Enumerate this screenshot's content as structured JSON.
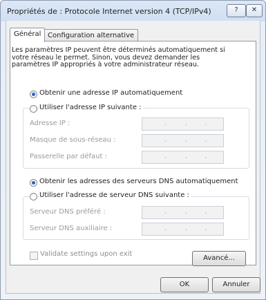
{
  "window": {
    "title": "Propriétés de : Protocole Internet version 4 (TCP/IPv4)",
    "help_label": "?",
    "close_label": "✕"
  },
  "tabs": [
    {
      "label": "Général",
      "active": true
    },
    {
      "label": "Configuration alternative",
      "active": false
    }
  ],
  "description": "Les paramètres IP peuvent être déterminés automatiquement si votre réseau le permet. Sinon, vous devez demander les paramètres IP appropriés à votre administrateur réseau.",
  "ip": {
    "auto_label": "Obtenir une adresse IP automatiquement",
    "manual_label": "Utiliser l'adresse IP suivante :",
    "selected": "auto",
    "fields": [
      {
        "label": "Adresse IP :"
      },
      {
        "label": "Masque de sous-réseau :"
      },
      {
        "label": "Passerelle par défaut :"
      }
    ]
  },
  "dns": {
    "auto_label": "Obtenir les adresses des serveurs DNS automatiquement",
    "manual_label": "Utiliser l'adresse de serveur DNS suivante :",
    "selected": "auto",
    "fields": [
      {
        "label": "Serveur DNS préféré :"
      },
      {
        "label": "Serveur DNS auxiliaire :"
      }
    ]
  },
  "ip_dots": ".",
  "validate_label": "Validate settings upon exit",
  "advanced_label": "Avancé...",
  "ok_label": "OK",
  "cancel_label": "Annuler"
}
